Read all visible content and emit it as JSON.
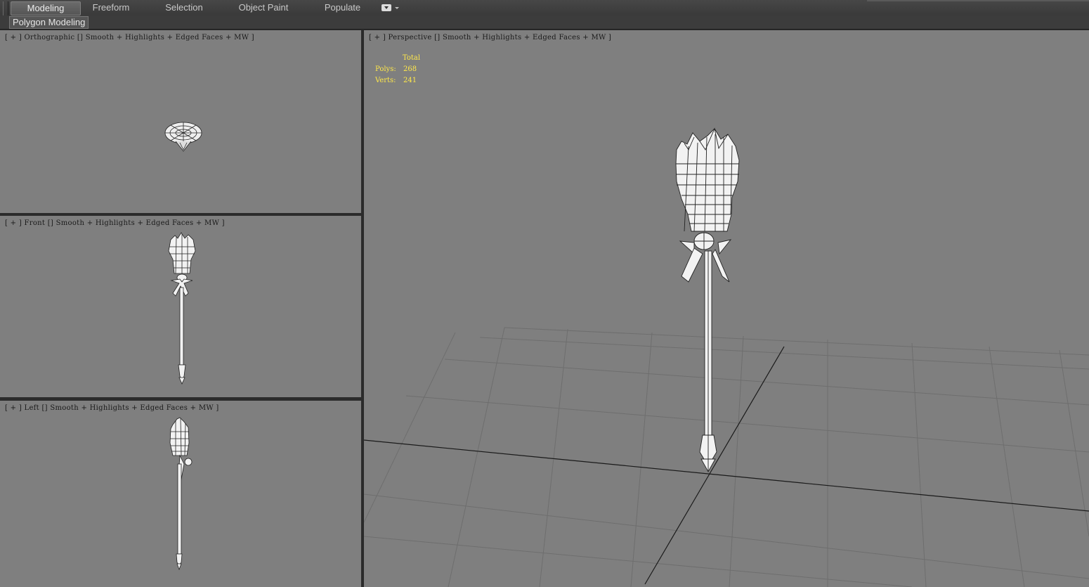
{
  "ribbon": {
    "tabs": [
      "Modeling",
      "Freeform",
      "Selection",
      "Object Paint",
      "Populate"
    ],
    "active_tab": "Modeling",
    "sub_tab": "Polygon Modeling"
  },
  "viewports": {
    "top": {
      "label": "[ + ] Orthographic [] Smooth + Highlights + Edged Faces + MW ]"
    },
    "front": {
      "label": "[ + ] Front [] Smooth + Highlights + Edged Faces + MW ]"
    },
    "left": {
      "label": "[ + ] Left [] Smooth + Highlights + Edged Faces + MW ]"
    },
    "perspective": {
      "label": "[ + ] Perspective [] Smooth + Highlights + Edged Faces + MW ]"
    }
  },
  "stats": {
    "header": "Total",
    "polys_label": "Polys:",
    "polys": "268",
    "verts_label": "Verts:",
    "verts": "241"
  },
  "colors": {
    "viewport_bg": "#7f7f7f",
    "stats_text": "#ffe84a",
    "ribbon_bg": "#3c3c3c"
  }
}
